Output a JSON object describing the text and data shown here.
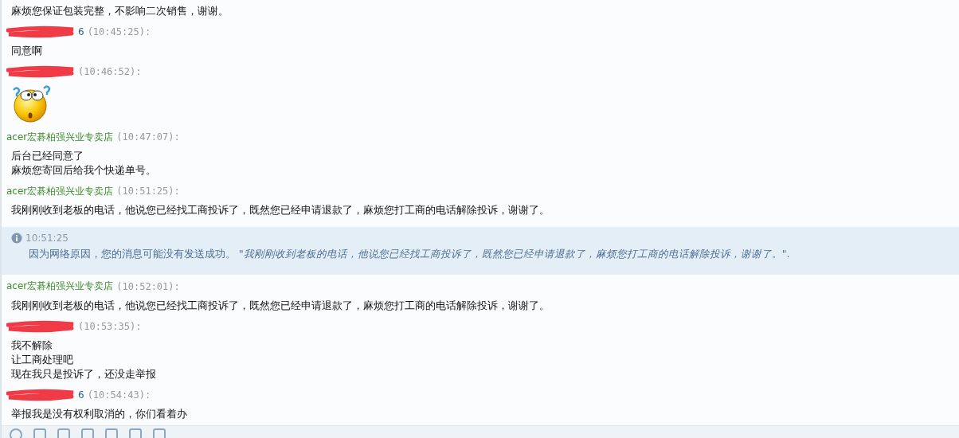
{
  "messages": [
    {
      "kind": "message",
      "lines": [
        "麻烦您保证包装完整，不影响二次销售，谢谢。"
      ]
    },
    {
      "kind": "message",
      "sender": {
        "kind": "buyer",
        "redacted": true,
        "tail": "6"
      },
      "time": "(10:45:25):",
      "lines": [
        "同意啊"
      ]
    },
    {
      "kind": "message",
      "sender": {
        "redacted": true
      },
      "time": "(10:46:52):",
      "sticker": true
    },
    {
      "kind": "message",
      "sender": {
        "kind": "shop",
        "name": "acer宏碁柏强兴业专卖店"
      },
      "time": "(10:47:07):",
      "lines": [
        "后台已经同意了",
        "麻烦您寄回后给我个快递单号。"
      ]
    },
    {
      "kind": "message",
      "sender": {
        "kind": "shop",
        "name": "acer宏碁柏强兴业专卖店"
      },
      "time": "(10:51:25):",
      "lines": [
        "我刚刚收到老板的电话，他说您已经找工商投诉了，既然您已经申请退款了，麻烦您打工商的电话解除投诉，谢谢了。"
      ]
    },
    {
      "kind": "notice",
      "time": "10:51:25",
      "text": "因为网络原因，您的消息可能没有发送成功。 *\"我刚刚收到老板的电话，他说您已经找工商投诉了，既然您已经申请退款了，麻烦您打工商的电话解除投诉，谢谢了。\"*."
    },
    {
      "kind": "message",
      "sender": {
        "kind": "shop",
        "name": "acer宏碁柏强兴业专卖店"
      },
      "time": "(10:52:01):",
      "lines": [
        "我刚刚收到老板的电话，他说您已经找工商投诉了，既然您已经申请退款了，麻烦您打工商的电话解除投诉，谢谢了。"
      ]
    },
    {
      "kind": "message",
      "sender": {
        "redacted": true
      },
      "time": "(10:53:35):",
      "lines": [
        "我不解除",
        "让工商处理吧",
        "现在我只是投诉了，还没走举报"
      ]
    },
    {
      "kind": "message",
      "sender": {
        "kind": "buyer",
        "redacted": true,
        "tail": "6"
      },
      "time": "(10:54:43):",
      "lines": [
        "举报我是没有权利取消的，你们看着办"
      ]
    }
  ]
}
